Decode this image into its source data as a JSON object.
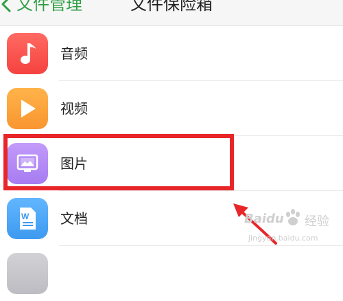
{
  "header": {
    "back_label": "文件管理",
    "title": "文件保险箱"
  },
  "items": [
    {
      "label": "音频",
      "icon": "music-note-icon",
      "color": "#fb5a57"
    },
    {
      "label": "视频",
      "icon": "play-icon",
      "color": "#fba43b"
    },
    {
      "label": "图片",
      "icon": "picture-icon",
      "color": "#b48af5"
    },
    {
      "label": "文档",
      "icon": "word-document-icon",
      "color": "#4fa8f5"
    },
    {
      "label": "",
      "icon": "archive-icon",
      "color": "#c8c8cc"
    }
  ],
  "watermark": {
    "brand": "Baidu",
    "jingyan": "经验",
    "url": "jingyan.baidu.com"
  },
  "annotation": {
    "highlight_color": "#e8262a"
  }
}
